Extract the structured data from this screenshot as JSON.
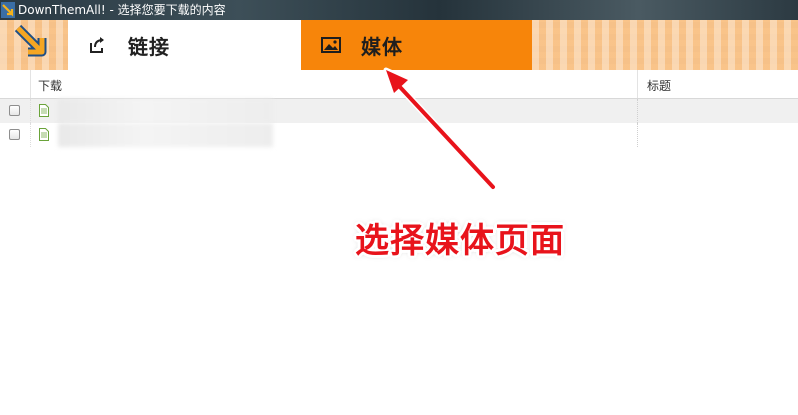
{
  "window": {
    "title": "DownThemAll! - 选择您要下载的内容"
  },
  "tabs": [
    {
      "label": "链接",
      "icon": "share-arrow-icon",
      "selected": false
    },
    {
      "label": "媒体",
      "icon": "image-icon",
      "selected": true
    }
  ],
  "table": {
    "columns": [
      {
        "label": "下载"
      },
      {
        "label": "标题"
      }
    ],
    "rows": [
      {
        "checked": false,
        "icon": "file-icon",
        "url": "",
        "title": ""
      },
      {
        "checked": false,
        "icon": "file-icon",
        "url": "",
        "title": ""
      }
    ]
  },
  "annotation": {
    "text": "选择媒体页面",
    "color": "#e8131b"
  },
  "colors": {
    "accent_tab": "#f7850a",
    "banner": "#f6c188"
  }
}
